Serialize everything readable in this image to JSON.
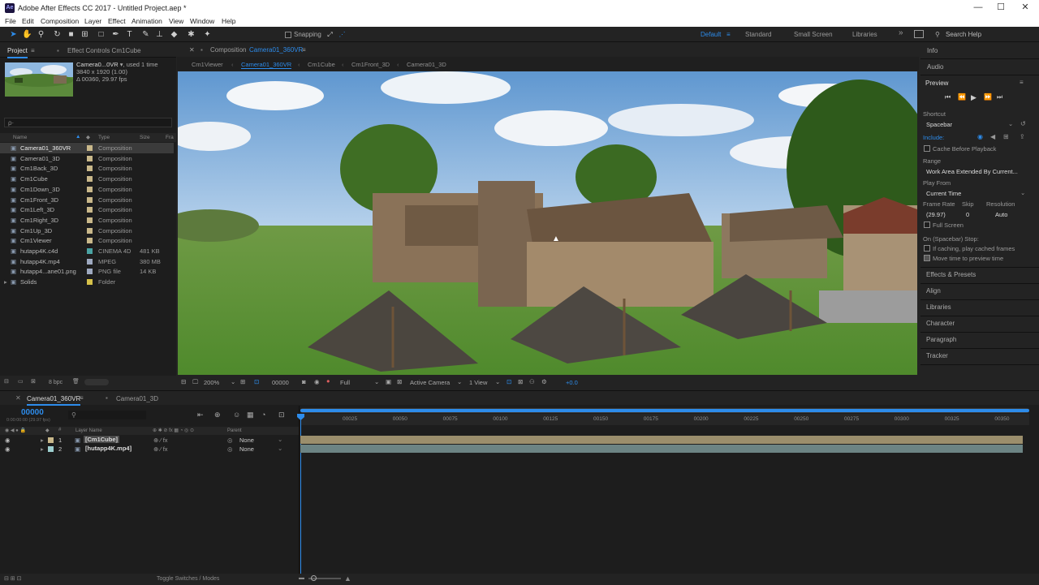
{
  "titlebar": {
    "app_icon": "Ae",
    "title": "Adobe After Effects CC 2017 - Untitled Project.aep *",
    "min": "—",
    "max": "☐",
    "close": "✕"
  },
  "menu": [
    "File",
    "Edit",
    "Composition",
    "Layer",
    "Effect",
    "Animation",
    "View",
    "Window",
    "Help"
  ],
  "toolbar": {
    "snapping": "Snapping",
    "workspaces": [
      "Default",
      "Standard",
      "Small Screen",
      "Libraries"
    ],
    "search": "Search Help"
  },
  "project": {
    "tab_project": "Project",
    "tab_effects": "Effect Controls Cm1Cube",
    "preview_name": "Camera0...0VR",
    "preview_used": ", used 1 time",
    "preview_dims": "3840 x 1920 (1.00)",
    "preview_dur": "Δ 00360, 29.97 fps",
    "search_placeholder": "ρ·",
    "col_name": "Name",
    "col_type": "Type",
    "col_size": "Size",
    "col_fr": "Fra",
    "items": [
      {
        "name": "Camera01_360VR",
        "type": "Composition",
        "size": "",
        "color": "#c9b88a"
      },
      {
        "name": "Camera01_3D",
        "type": "Composition",
        "size": "",
        "color": "#c9b88a"
      },
      {
        "name": "Cm1Back_3D",
        "type": "Composition",
        "size": "",
        "color": "#c9b88a"
      },
      {
        "name": "Cm1Cube",
        "type": "Composition",
        "size": "",
        "color": "#c9b88a"
      },
      {
        "name": "Cm1Down_3D",
        "type": "Composition",
        "size": "",
        "color": "#c9b88a"
      },
      {
        "name": "Cm1Front_3D",
        "type": "Composition",
        "size": "",
        "color": "#c9b88a"
      },
      {
        "name": "Cm1Left_3D",
        "type": "Composition",
        "size": "",
        "color": "#c9b88a"
      },
      {
        "name": "Cm1Right_3D",
        "type": "Composition",
        "size": "",
        "color": "#c9b88a"
      },
      {
        "name": "Cm1Up_3D",
        "type": "Composition",
        "size": "",
        "color": "#c9b88a"
      },
      {
        "name": "Cm1Viewer",
        "type": "Composition",
        "size": "",
        "color": "#c9b88a"
      },
      {
        "name": "hutapp4K.c4d",
        "type": "CINEMA 4D",
        "size": "481 KB",
        "color": "#4aa3a3"
      },
      {
        "name": "hutapp4K.mp4",
        "type": "MPEG",
        "size": "380 MB",
        "color": "#9ea9c0"
      },
      {
        "name": "hutapp4...ane01.png",
        "type": "PNG file",
        "size": "14 KB",
        "color": "#9ea9c0"
      },
      {
        "name": "Solids",
        "type": "Folder",
        "size": "",
        "color": "#d6c24a"
      }
    ],
    "bpc": "8 bpc"
  },
  "comp": {
    "tab": "Composition",
    "tab_name": "Camera01_360VR",
    "breadcrumbs": [
      "Cm1Viewer",
      "Camera01_360VR",
      "Cm1Cube",
      "Cm1Front_3D",
      "Camera01_3D"
    ],
    "zoom": "200%",
    "timecode": "00000",
    "resolution": "Full",
    "camera": "Active Camera",
    "views": "1 View",
    "exposure": "+0.0"
  },
  "right": {
    "info": "Info",
    "audio": "Audio",
    "preview": "Preview",
    "shortcut_label": "Shortcut",
    "shortcut": "Spacebar",
    "include": "Include:",
    "cache": "Cache Before Playback",
    "range_label": "Range",
    "range": "Work Area Extended By Current...",
    "playfrom_label": "Play From",
    "playfrom": "Current Time",
    "fr_label": "Frame Rate",
    "skip_label": "Skip",
    "res_label": "Resolution",
    "fr": "(29.97)",
    "skip": "0",
    "res": "Auto",
    "fullscreen": "Full Screen",
    "onstop": "On (Spacebar) Stop:",
    "ifcaching": "If caching, play cached frames",
    "movetime": "Move time to preview time",
    "panels": [
      "Effects & Presets",
      "Align",
      "Libraries",
      "Character",
      "Paragraph",
      "Tracker"
    ]
  },
  "timeline": {
    "tab1": "Camera01_360VR",
    "tab2": "Camera01_3D",
    "timecode": "00000",
    "timecode_sub": "0:00:00:00 (29.97 fps)",
    "col_layer": "Layer Name",
    "col_parent": "Parent",
    "layers": [
      {
        "num": "1",
        "name": "[Cm1Cube]",
        "parent": "None",
        "color": "#c9b88a",
        "bar": "#9b8e6c"
      },
      {
        "num": "2",
        "name": "[hutapp4K.mp4]",
        "parent": "None",
        "color": "#9ecfcf",
        "bar": "#6c8484"
      }
    ],
    "ruler": [
      "00025",
      "00050",
      "00075",
      "00100",
      "00125",
      "00150",
      "00175",
      "00200",
      "00225",
      "00250",
      "00275",
      "00300",
      "00325",
      "00350"
    ],
    "toggle": "Toggle Switches / Modes"
  }
}
